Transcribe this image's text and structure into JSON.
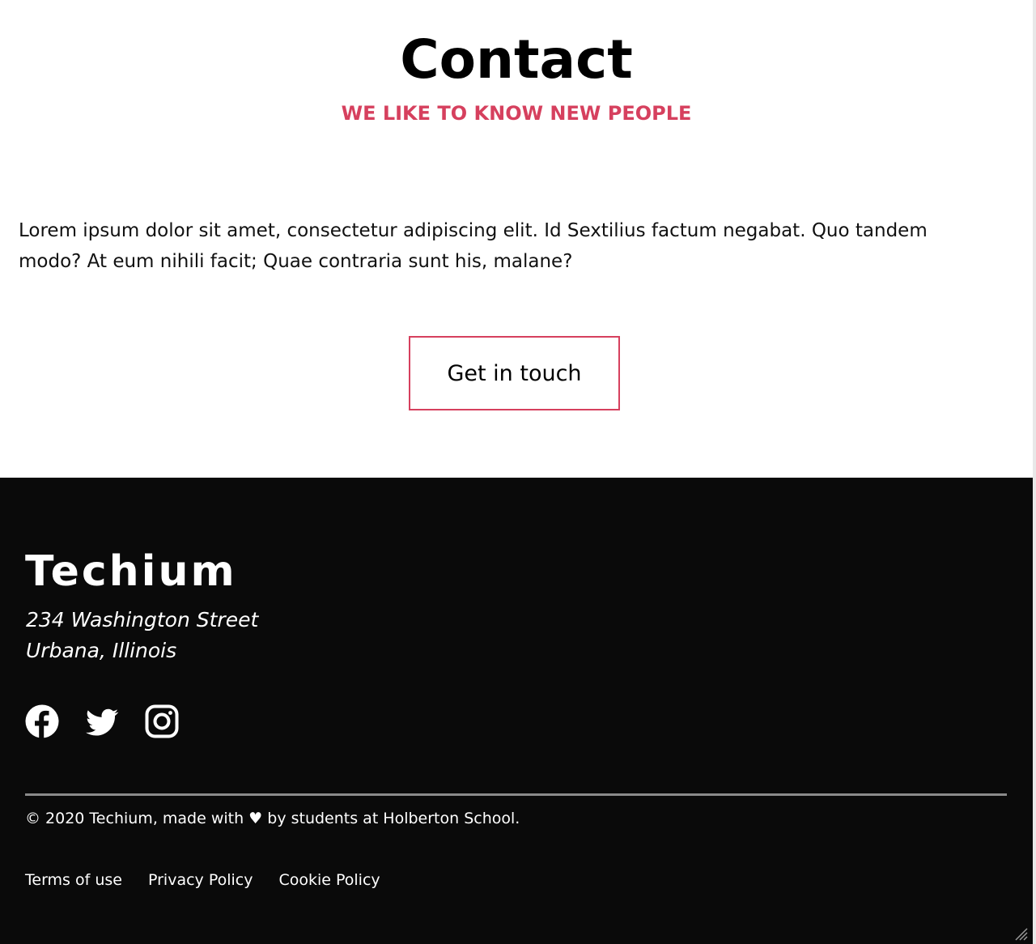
{
  "contact": {
    "title": "Contact",
    "subtitle": "WE LIKE TO KNOW NEW PEOPLE",
    "text": "Lorem ipsum dolor sit amet, consectetur adipiscing elit. Id Sextilius factum negabat. Quo tandem modo? At eum nihili facit; Quae contraria sunt his, malane?",
    "button_label": "Get in touch"
  },
  "footer": {
    "logo": "Techium",
    "address_line1": "234 Washington Street",
    "address_line2": "Urbana, Illinois",
    "social": [
      {
        "icon": "facebook-icon"
      },
      {
        "icon": "twitter-icon"
      },
      {
        "icon": "instagram-icon"
      }
    ],
    "copyright": "© 2020 Techium, made with ♥ by students at Holberton School.",
    "links": [
      {
        "label": "Terms of use"
      },
      {
        "label": "Privacy Policy"
      },
      {
        "label": "Cookie Policy"
      }
    ]
  },
  "colors": {
    "accent": "#d6405e",
    "footer_bg": "#0a0a0a",
    "divider": "#8a8a8a"
  }
}
